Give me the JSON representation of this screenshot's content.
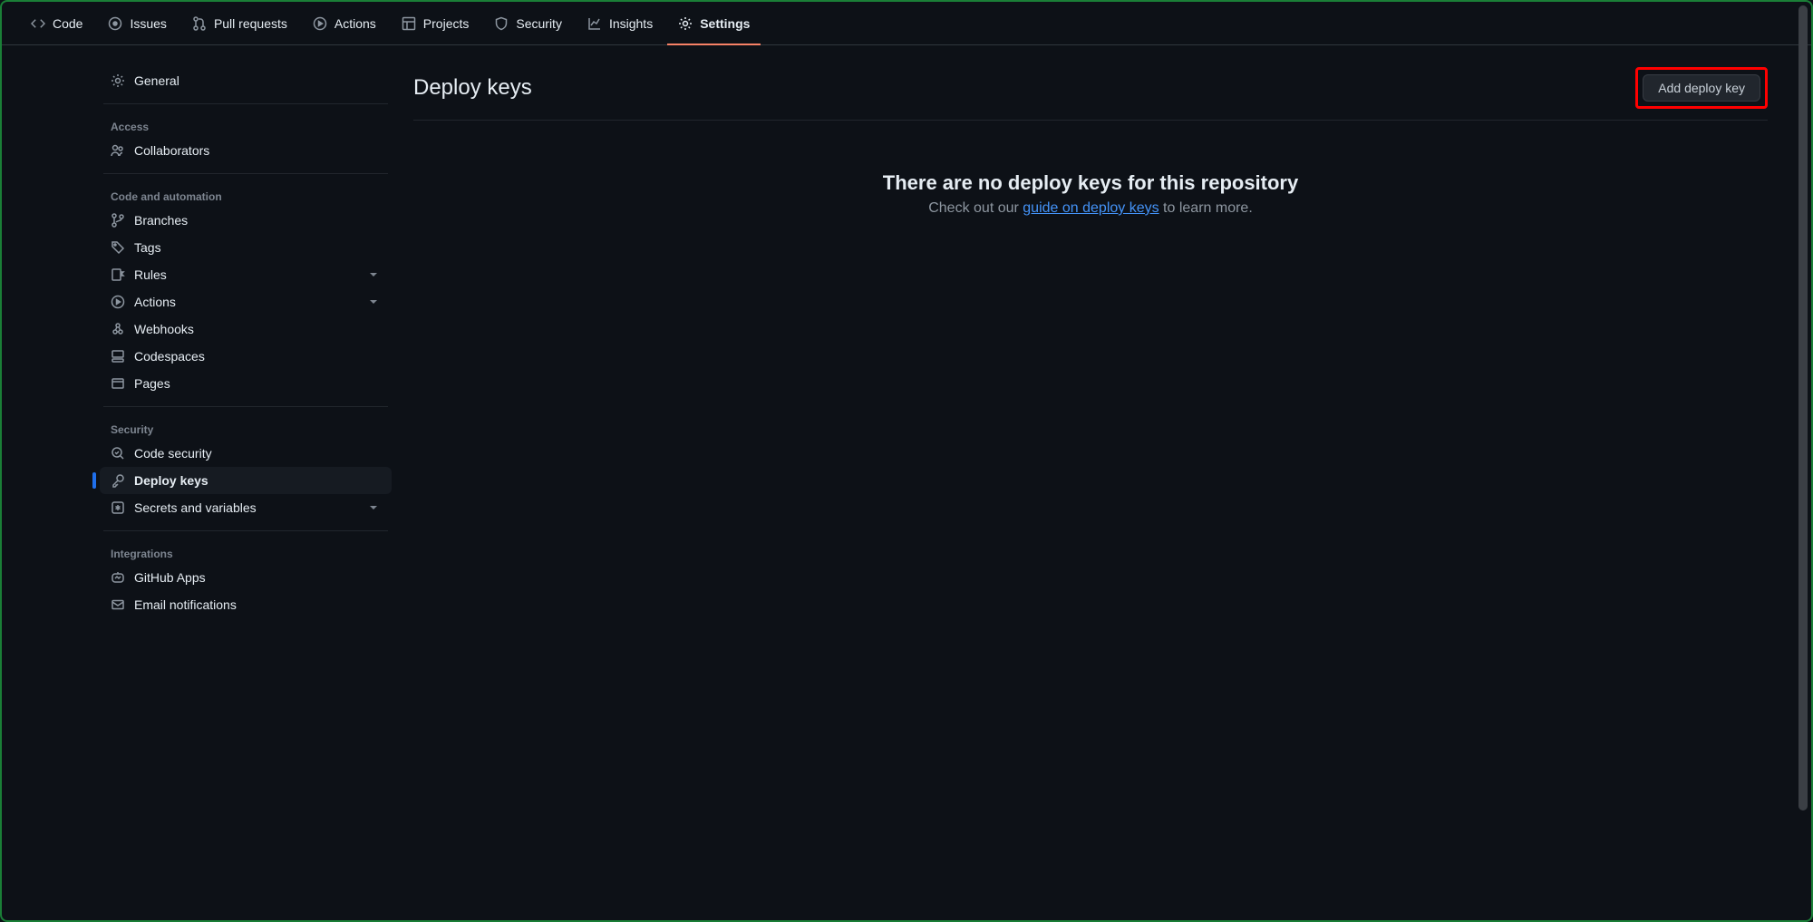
{
  "topnav": [
    {
      "label": "Code",
      "icon": "code"
    },
    {
      "label": "Issues",
      "icon": "issue"
    },
    {
      "label": "Pull requests",
      "icon": "pr"
    },
    {
      "label": "Actions",
      "icon": "play"
    },
    {
      "label": "Projects",
      "icon": "table"
    },
    {
      "label": "Security",
      "icon": "shield"
    },
    {
      "label": "Insights",
      "icon": "graph"
    },
    {
      "label": "Settings",
      "icon": "gear"
    }
  ],
  "sidebar": {
    "general": "General",
    "groups": [
      {
        "heading": "Access",
        "items": [
          {
            "label": "Collaborators",
            "icon": "people"
          }
        ]
      },
      {
        "heading": "Code and automation",
        "items": [
          {
            "label": "Branches",
            "icon": "branch"
          },
          {
            "label": "Tags",
            "icon": "tag"
          },
          {
            "label": "Rules",
            "icon": "rules",
            "expandable": true
          },
          {
            "label": "Actions",
            "icon": "play",
            "expandable": true
          },
          {
            "label": "Webhooks",
            "icon": "webhook"
          },
          {
            "label": "Codespaces",
            "icon": "codespaces"
          },
          {
            "label": "Pages",
            "icon": "browser"
          }
        ]
      },
      {
        "heading": "Security",
        "items": [
          {
            "label": "Code security",
            "icon": "codescan"
          },
          {
            "label": "Deploy keys",
            "icon": "key",
            "active": true
          },
          {
            "label": "Secrets and variables",
            "icon": "asterisk",
            "expandable": true
          }
        ]
      },
      {
        "heading": "Integrations",
        "items": [
          {
            "label": "GitHub Apps",
            "icon": "hubot"
          },
          {
            "label": "Email notifications",
            "icon": "mail"
          }
        ]
      }
    ]
  },
  "main": {
    "title": "Deploy keys",
    "add_button": "Add deploy key",
    "empty_title": "There are no deploy keys for this repository",
    "empty_prefix": "Check out our ",
    "empty_link": "guide on deploy keys",
    "empty_suffix": " to learn more."
  }
}
